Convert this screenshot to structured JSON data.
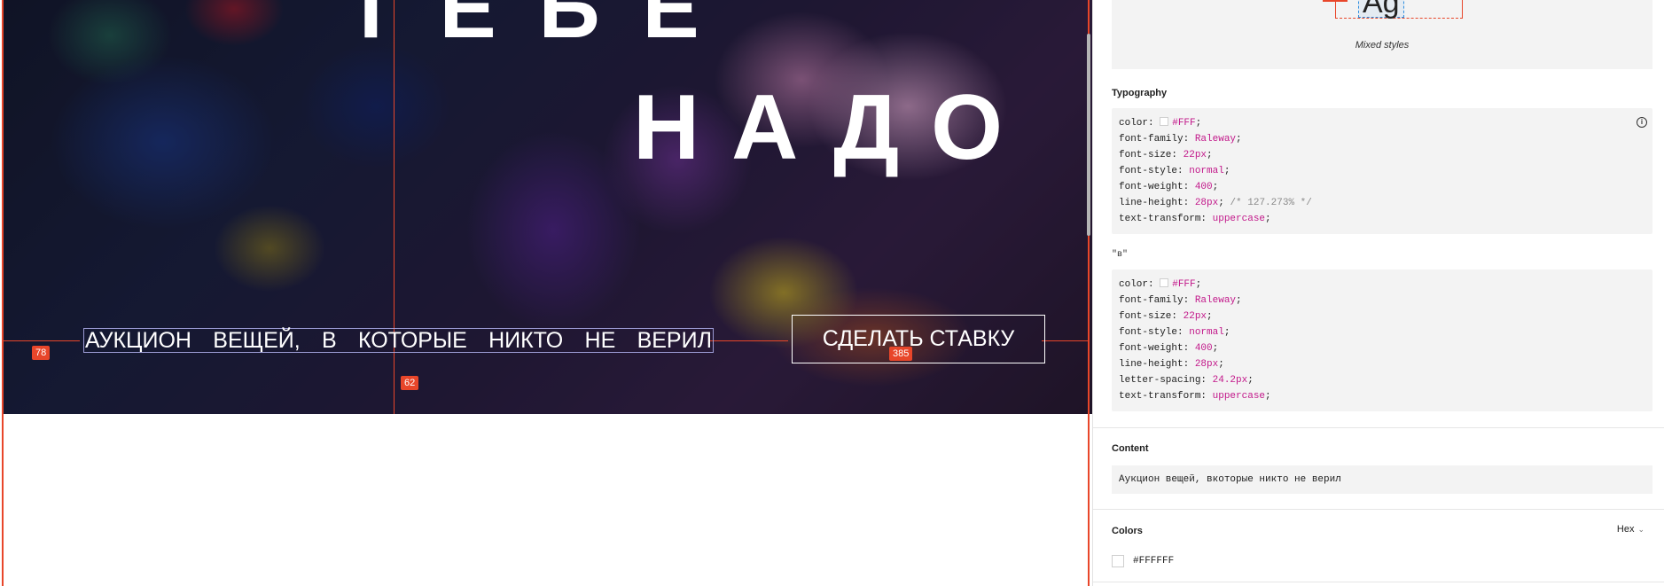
{
  "hero": {
    "line1": "ТЕБЕ",
    "line2": "НАДО",
    "tagline_words": [
      "Аукцион",
      "вещей,",
      "в",
      "которые",
      "никто",
      "не",
      "верил"
    ],
    "cta_label": "Сделать ставку",
    "badges": {
      "left": "78",
      "bottom": "62",
      "cta": "385"
    }
  },
  "panel": {
    "preview_glyph": "Ag",
    "preview_caption": "Mixed styles",
    "typography_title": "Typography",
    "block1": {
      "color": "#FFF",
      "font_family": "Raleway",
      "font_size": "22px",
      "font_style": "normal",
      "font_weight": "400",
      "line_height": "28px",
      "line_height_comment": "/* 127.273% */",
      "text_transform": "uppercase"
    },
    "block2_label": "\"в\"",
    "block2": {
      "color": "#FFF",
      "font_family": "Raleway",
      "font_size": "22px",
      "font_style": "normal",
      "font_weight": "400",
      "line_height": "28px",
      "letter_spacing": "24.2px",
      "text_transform": "uppercase"
    },
    "content_title": "Content",
    "content_text": "Аукцион вещей, вкоторые никто не верил",
    "colors_title": "Colors",
    "colors_format": "Hex",
    "color_value": "#FFFFFF"
  },
  "colors": {
    "guide": "#e8462a",
    "code_value": "#c2188a",
    "panel_bg": "#f3f3f3"
  }
}
